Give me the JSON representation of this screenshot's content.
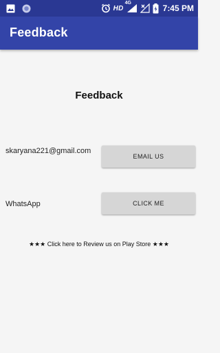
{
  "status_bar": {
    "network_label": "HD",
    "network_type": "4G",
    "time": "7:45 PM",
    "icons": [
      "image-icon",
      "circle-notification-icon",
      "alarm-icon",
      "signal-icon",
      "no-signal-icon",
      "battery-charging-icon"
    ]
  },
  "app_bar": {
    "title": "Feedback",
    "color": "#3344a8"
  },
  "content": {
    "heading": "Feedback",
    "email_label": "skaryana221@gmail.com",
    "email_button": "EMAIL US",
    "whatsapp_label": "WhatsApp",
    "whatsapp_button": "CLICK ME",
    "review_text": "★★★ Click here to Review us on Play Store ★★★"
  }
}
